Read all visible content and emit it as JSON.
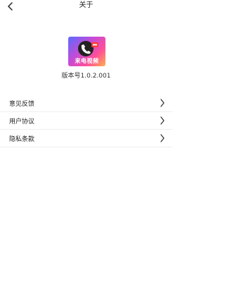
{
  "header": {
    "title": "关于",
    "back_icon": "chevron-left-icon"
  },
  "app": {
    "logo_text": "来电视频",
    "version_text": "版本号1.0.2.001"
  },
  "menu": {
    "items": [
      {
        "label": "意见反馈",
        "icon": "chevron-right-icon"
      },
      {
        "label": "用户协议",
        "icon": "chevron-right-icon"
      },
      {
        "label": "隐私条款",
        "icon": "chevron-right-icon"
      }
    ]
  }
}
